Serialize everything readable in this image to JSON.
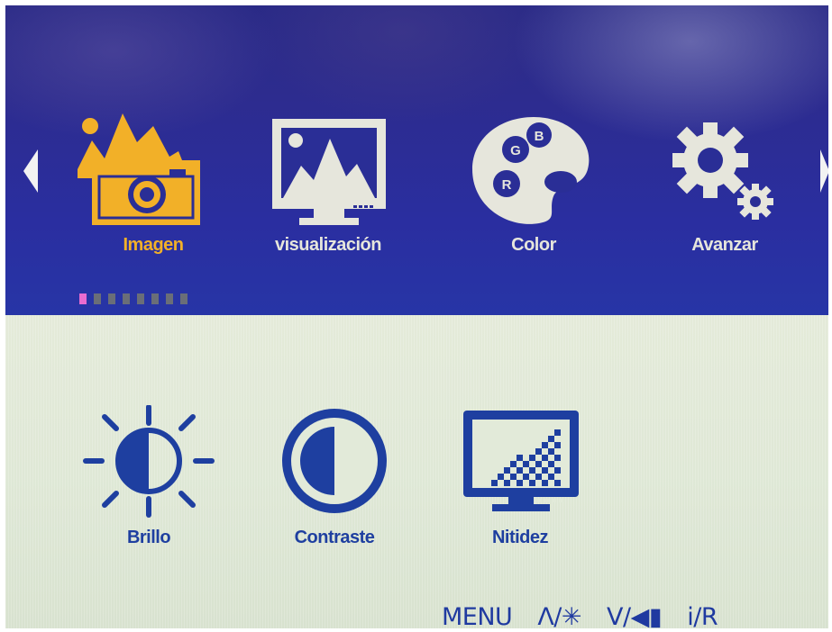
{
  "osd": {
    "main_menu": {
      "tabs": [
        {
          "label": "Imagen",
          "icon": "image-camera-icon",
          "active": true
        },
        {
          "label": "visualización",
          "icon": "display-picture-icon",
          "active": false
        },
        {
          "label": "Color",
          "icon": "color-palette-icon",
          "active": false
        },
        {
          "label": "Avanzar",
          "icon": "gears-icon",
          "active": false
        }
      ],
      "page_indicator": {
        "total": 8,
        "current": 1
      }
    },
    "sub_menu": {
      "items": [
        {
          "label": "Brillo",
          "icon": "brightness-icon"
        },
        {
          "label": "Contraste",
          "icon": "contrast-icon"
        },
        {
          "label": "Nitidez",
          "icon": "sharpness-icon"
        }
      ]
    },
    "footer": {
      "menu": "MENU",
      "up": "Λ/✳",
      "down": "V/◀▮",
      "info": "i/R"
    },
    "colors": {
      "menu_bar": "#2a2e96",
      "active_accent": "#f2b028",
      "inactive_icon": "#e6e6dc",
      "content_icon": "#1e3fa0",
      "content_bg": "#dfe8d8",
      "page_dot_active": "#e86cd0"
    }
  }
}
